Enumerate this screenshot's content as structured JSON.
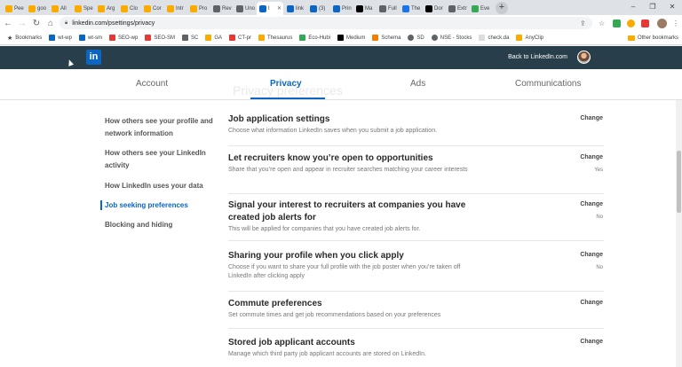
{
  "browser": {
    "tabs": [
      {
        "label": "Pee",
        "color": "#f9ab00"
      },
      {
        "label": "goo",
        "color": "#f9ab00"
      },
      {
        "label": "All",
        "color": "#f9ab00"
      },
      {
        "label": "Spe",
        "color": "#f9ab00"
      },
      {
        "label": "Arg",
        "color": "#f9ab00"
      },
      {
        "label": "Clo",
        "color": "#f9ab00"
      },
      {
        "label": "Cor",
        "color": "#f9ab00"
      },
      {
        "label": "Intr",
        "color": "#f9ab00"
      },
      {
        "label": "Pro",
        "color": "#f9ab00"
      },
      {
        "label": "Rev",
        "color": "#5f6368"
      },
      {
        "label": "Uno",
        "color": "#5f6368"
      },
      {
        "label": "I",
        "color": "#0a66c2",
        "active": true
      },
      {
        "label": "link",
        "color": "#0a66c2"
      },
      {
        "label": "(3)",
        "color": "#0a66c2"
      },
      {
        "label": "Prin",
        "color": "#0a66c2"
      },
      {
        "label": "Ma",
        "color": "#000000"
      },
      {
        "label": "Full",
        "color": "#5f6368"
      },
      {
        "label": "The",
        "color": "#1a73e8"
      },
      {
        "label": "Dor",
        "color": "#000000"
      },
      {
        "label": "Extr",
        "color": "#5f6368"
      },
      {
        "label": "Eve",
        "color": "#34a853"
      }
    ],
    "new_tab": "+",
    "window_controls": [
      "–",
      "❐",
      "✕"
    ],
    "url": "linkedin.com/psettings/privacy",
    "bookmarks": [
      {
        "label": "Bookmarks",
        "color": "#5f6368"
      },
      {
        "label": "wt-wp",
        "color": "#0a66c2"
      },
      {
        "label": "wt-sm",
        "color": "#0a66c2"
      },
      {
        "label": "SEO-wp",
        "color": "#e53935"
      },
      {
        "label": "SEO-SM",
        "color": "#e53935"
      },
      {
        "label": "SC",
        "color": "#5f6368"
      },
      {
        "label": "GA",
        "color": "#f9ab00"
      },
      {
        "label": "CT-pr",
        "color": "#e53935"
      },
      {
        "label": "Thesaurus",
        "color": "#f9ab00"
      },
      {
        "label": "Eco-Hubi",
        "color": "#34a853"
      },
      {
        "label": "Medium",
        "color": "#000000"
      },
      {
        "label": "Schema",
        "color": "#f57c00"
      },
      {
        "label": "SD",
        "color": "#5f6368"
      },
      {
        "label": "NSE - Stocks",
        "color": "#5f6368"
      },
      {
        "label": "check.da",
        "color": "#5f6368"
      },
      {
        "label": "AnyClip",
        "color": "#f9ab00"
      }
    ],
    "other_bookmarks": "Other bookmarks"
  },
  "header": {
    "logo": "in",
    "back_link": "Back to LinkedIn.com"
  },
  "subnav": {
    "ghost_text": "Privacy preferences",
    "tabs": [
      {
        "label": "Account"
      },
      {
        "label": "Privacy"
      },
      {
        "label": "Ads"
      },
      {
        "label": "Communications"
      }
    ]
  },
  "sidebar": {
    "items": [
      {
        "label": "How others see your profile and network information"
      },
      {
        "label": "How others see your LinkedIn activity"
      },
      {
        "label": "How LinkedIn uses your data"
      },
      {
        "label": "Job seeking preferences"
      },
      {
        "label": "Blocking and hiding"
      }
    ]
  },
  "settings": [
    {
      "title": "Job application settings",
      "desc": "Choose what information LinkedIn saves when you submit a job application.",
      "action": "Change",
      "status": ""
    },
    {
      "title": "Let recruiters know you’re open to opportunities",
      "desc": "Share that you’re open and appear in recruiter searches matching your career interests",
      "action": "Change",
      "status": "Yes"
    },
    {
      "title": "Signal your interest to recruiters at companies you have created job alerts for",
      "desc": "This will be applied for companies that you have created job alerts for.",
      "action": "Change",
      "status": "No"
    },
    {
      "title": "Sharing your profile when you click apply",
      "desc": "Choose if you want to share your full profile with the job poster when you’re taken off LinkedIn after clicking apply",
      "action": "Change",
      "status": "No"
    },
    {
      "title": "Commute preferences",
      "desc": "Set commute times and get job recommendations based on your preferences",
      "action": "Change",
      "status": ""
    },
    {
      "title": "Stored job applicant accounts",
      "desc": "Manage which third party job applicant accounts are stored on LinkedIn.",
      "action": "Change",
      "status": ""
    }
  ],
  "colors": {
    "accent": "#0a66c2",
    "header_bg": "#283e4a"
  }
}
